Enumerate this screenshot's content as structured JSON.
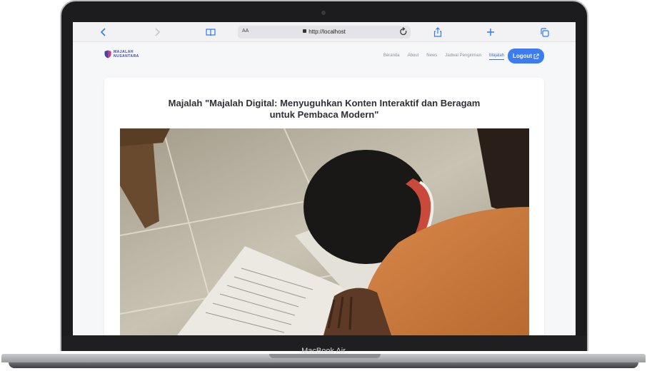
{
  "device": {
    "label": "MacBook Air"
  },
  "browser": {
    "reader_label": "AA",
    "url": "http://localhost",
    "icons": [
      "chevron-left-icon",
      "chevron-right-icon",
      "book-icon",
      "lock-icon",
      "reload-icon",
      "share-icon",
      "plus-icon",
      "tabs-icon"
    ]
  },
  "site": {
    "logo_line1": "MAJALAH",
    "logo_line2": "NUSANTARA",
    "nav": [
      {
        "label": "Beranda",
        "active": false
      },
      {
        "label": "About",
        "active": false
      },
      {
        "label": "News",
        "active": false
      },
      {
        "label": "Jadwal Pengiriman",
        "active": false
      },
      {
        "label": "Majalah",
        "active": true
      }
    ],
    "logout_label": "Logout"
  },
  "article": {
    "title": "Majalah \"Majalah Digital: Menyuguhkan Konten Interaktif dan Beragam untuk Pembaca Modern\""
  },
  "colors": {
    "accent": "#3d7cf0",
    "brand": "#3b49a5",
    "title": "#2f3038"
  }
}
